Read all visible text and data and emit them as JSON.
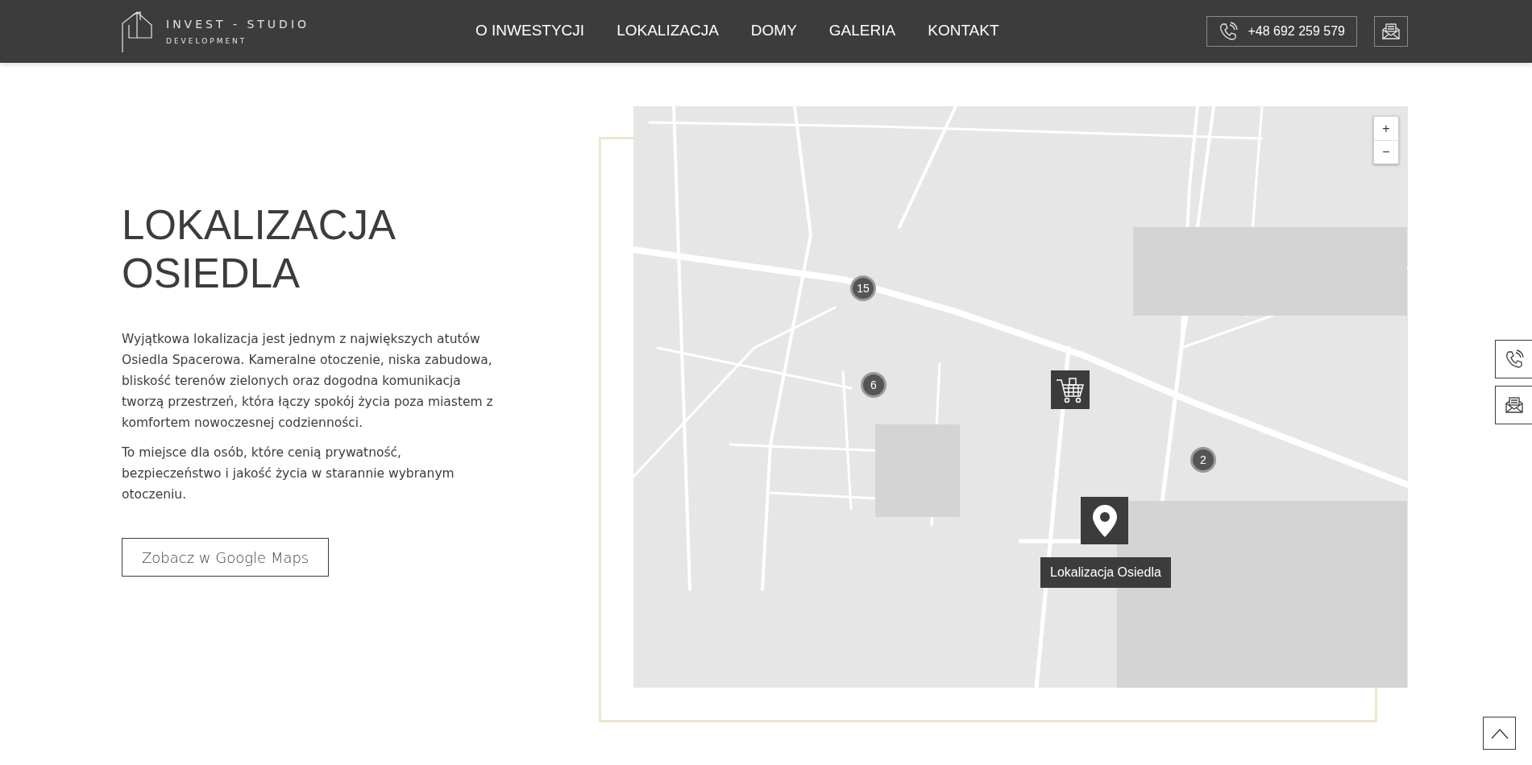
{
  "header": {
    "logo": {
      "title": "INVEST - STUDIO",
      "subtitle": "DEVELOPMENT"
    },
    "nav": [
      {
        "label": "O INWESTYCJI",
        "selected": false
      },
      {
        "label": "LOKALIZACJA",
        "selected": false
      },
      {
        "label": "DOMY",
        "selected": false
      },
      {
        "label": "GALERIA",
        "selected": false
      },
      {
        "label": "KONTAKT",
        "selected": false
      }
    ],
    "phone": "+48 692 259 579"
  },
  "section": {
    "heading": "LOKALIZACJA OSIEDLA",
    "paragraphs": [
      "Wyjątkowa lokalizacja jest jednym z największych atutów Osiedla Spacerowa. Kameralne otoczenie, niska zabudowa, bliskość terenów zielonych oraz dogodna komunikacja tworzą przestrzeń, która łączy spokój życia poza miastem z komfortem nowoczesnej codzienności.",
      "To miejsce dla osób, które cenią prywatność, bezpieczeństwo i jakość życia w starannie wybranym otoczeniu."
    ],
    "button": "Zobacz w Google Maps"
  },
  "map": {
    "zoom_controls": [
      "+",
      "−"
    ],
    "markers": [
      {
        "kind": "cluster",
        "count": "15"
      },
      {
        "kind": "cluster",
        "count": "6"
      },
      {
        "kind": "cluster",
        "count": "2"
      },
      {
        "kind": "shop"
      },
      {
        "kind": "location",
        "tooltip": "Lokalizacja Osiedla"
      }
    ]
  }
}
